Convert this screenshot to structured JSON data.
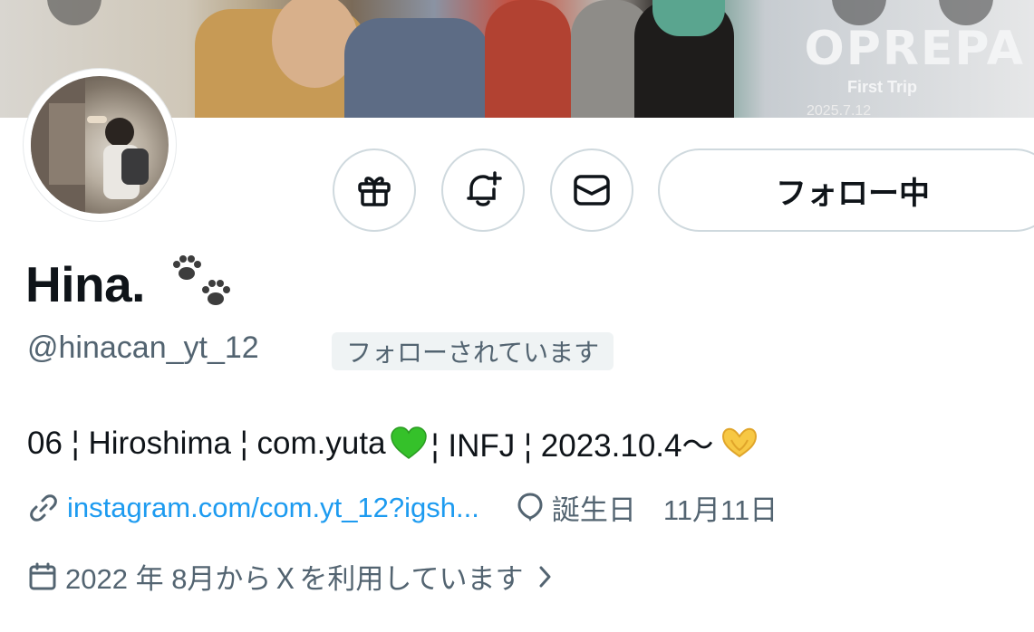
{
  "banner": {
    "logo_text": "OPREPA",
    "subtitle": "First Trip",
    "date": "2025.7.12"
  },
  "profile": {
    "display_name": "Hina.",
    "handle": "@hinacan_yt_12",
    "followed_badge": "フォローされています",
    "bio_parts": [
      "06 ¦ Hiroshima ¦ com.yuta",
      " ¦ INFJ ¦ 2023.10.4～"
    ],
    "link": "instagram.com/com.yt_12?igsh...",
    "birthday_label": "誕生日",
    "birthday_value": "11月11日",
    "joined": "2022 年 8月からＸを利用しています"
  },
  "actions": {
    "follow_label": "フォロー中",
    "icons": [
      "gift-icon",
      "notification-bell-plus-icon",
      "message-envelope-icon"
    ]
  },
  "colors": {
    "link": "#1d9bf0",
    "secondary_text": "#536471",
    "border": "#cfd9de",
    "badge_bg": "#eff3f4"
  }
}
